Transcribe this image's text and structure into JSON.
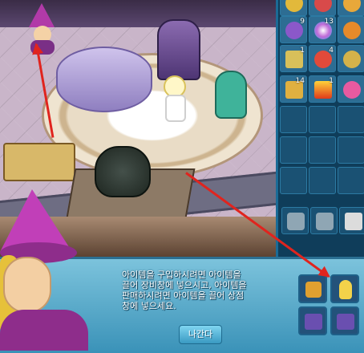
{
  "dialog": {
    "message": "아이템을 구입하시려면 아이템을\n끌어 장비창에 넣으시고, 아이템을\n판매하시려면 아이템을 끌어 상점\n창에 넣으세요.",
    "exit_label": "나간다"
  },
  "inventory": {
    "items": [
      {
        "icon": "gold-coin-icon",
        "count": ""
      },
      {
        "icon": "red-box-icon",
        "count": ""
      },
      {
        "icon": "gold-orb-icon",
        "count": ""
      },
      {
        "icon": "purple-crystal-icon",
        "count": "9"
      },
      {
        "icon": "rainbow-orb-icon",
        "count": "13"
      },
      {
        "icon": "orange-orb-icon",
        "count": ""
      },
      {
        "icon": "scroll-icon",
        "count": "1"
      },
      {
        "icon": "doll-icon",
        "count": "4"
      },
      {
        "icon": "mask-icon",
        "count": ""
      },
      {
        "icon": "treasure-chest-icon",
        "count": "14"
      },
      {
        "icon": "fire-card-icon",
        "count": "1"
      },
      {
        "icon": "flower-icon",
        "count": ""
      }
    ],
    "bottom": [
      {
        "icon": "lantern-icon"
      },
      {
        "icon": "lantern-icon"
      },
      {
        "icon": "trash-can-icon"
      }
    ]
  },
  "shop": {
    "items": [
      {
        "icon": "shield-emblem-icon"
      },
      {
        "icon": "potion-flask-icon"
      },
      {
        "icon": "magic-book-icon"
      },
      {
        "icon": "magic-book-icon"
      }
    ]
  }
}
